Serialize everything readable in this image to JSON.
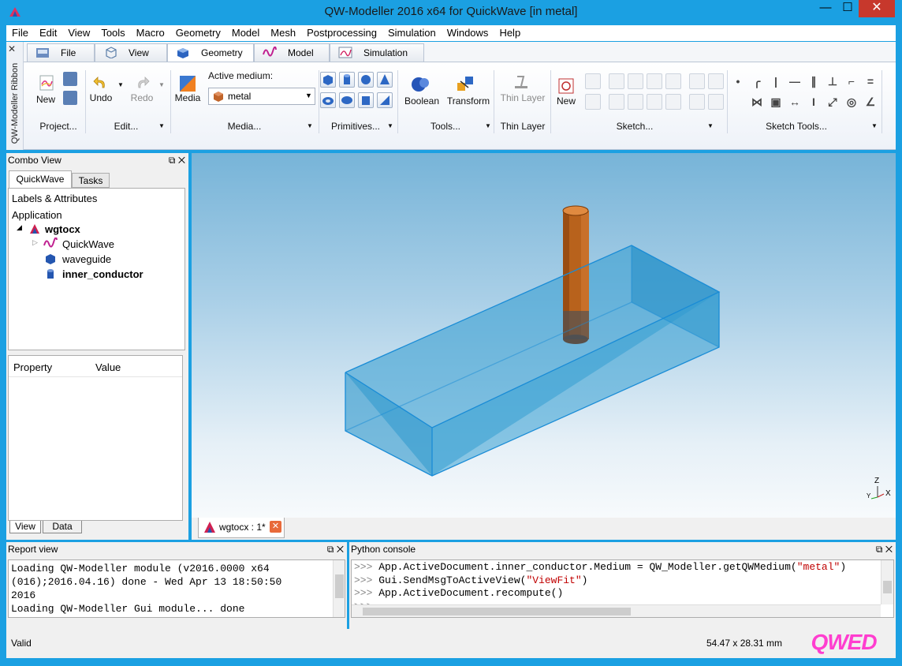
{
  "window": {
    "title": "QW-Modeller 2016 x64  for QuickWave [in metal]",
    "min": "—",
    "max": "☐",
    "close": "✕"
  },
  "menu": [
    "File",
    "Edit",
    "View",
    "Tools",
    "Macro",
    "Geometry",
    "Model",
    "Mesh",
    "Postprocessing",
    "Simulation",
    "Windows",
    "Help"
  ],
  "ribbon": {
    "side_label": "QW-Modeller Ribbon",
    "side_close": "✕",
    "tabs": [
      {
        "label": "File"
      },
      {
        "label": "View"
      },
      {
        "label": "Geometry"
      },
      {
        "label": "Model"
      },
      {
        "label": "Simulation"
      }
    ],
    "buttons": {
      "new": "New",
      "undo": "Undo",
      "redo": "Redo",
      "media": "Media",
      "active_medium_label": "Active medium:",
      "active_medium_value": "metal",
      "boolean": "Boolean",
      "transform": "Transform",
      "thin_layer": "Thin Layer",
      "sketch_new": "New"
    },
    "groups": {
      "project": "Project...",
      "edit": "Edit...",
      "media": "Media...",
      "primitives": "Primitives...",
      "tools": "Tools...",
      "thin_layer": "Thin Layer",
      "sketch": "Sketch...",
      "sketch_tools": "Sketch Tools..."
    }
  },
  "combo": {
    "title": "Combo View",
    "tab_quickwave": "QuickWave",
    "tab_tasks": "Tasks",
    "tree_header": "Labels & Attributes",
    "tree_root": "Application",
    "tree": [
      {
        "label": "wgtocx",
        "bold": true
      },
      {
        "label": "QuickWave",
        "bold": false
      },
      {
        "label": "waveguide",
        "bold": false
      },
      {
        "label": "inner_conductor",
        "bold": true
      }
    ],
    "prop_col1": "Property",
    "prop_col2": "Value",
    "bottom_tab_view": "View",
    "bottom_tab_data": "Data"
  },
  "doc_tab": {
    "label": "wgtocx : 1*"
  },
  "axis": {
    "z": "Z",
    "x": "X",
    "y": "Y"
  },
  "report": {
    "title": "Report view",
    "lines": "Loading QW-Modeller module (v2016.0000 x64\n(016);2016.04.16) done - Wed Apr 13 18:50:50\n2016\nLoading QW-Modeller Gui module... done"
  },
  "python": {
    "title": "Python console",
    "lines": [
      {
        "prompt": ">>> ",
        "code": "App.ActiveDocument.inner_conductor.Medium = QW_Modeller.getQWMedium(",
        "str": "\"metal\"",
        "tail": ")"
      },
      {
        "prompt": ">>> ",
        "code": "Gui.SendMsgToActiveView(",
        "str": "\"ViewFit\"",
        "tail": ")"
      },
      {
        "prompt": ">>> ",
        "code": "App.ActiveDocument.recompute()",
        "str": "",
        "tail": ""
      },
      {
        "prompt": ">>>",
        "code": "",
        "str": "",
        "tail": ""
      }
    ]
  },
  "status": {
    "left": "Valid",
    "dims": "54.47 x 28.31 mm",
    "logo": "QWED"
  },
  "colors": {
    "titlebar": "#1ba0e2",
    "box_face": "#3fa9d8",
    "conductor": "#b8621c",
    "logo": "#ff3ecf"
  }
}
